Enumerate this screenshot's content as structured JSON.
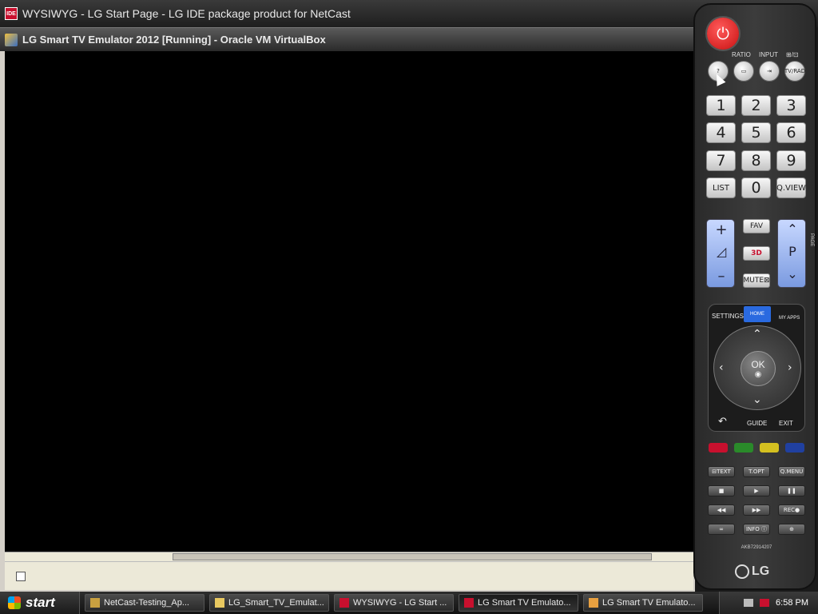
{
  "outer_window": {
    "title": "WYSIWYG - LG Start Page - LG IDE package product for NetCast",
    "icon_text": "IDE"
  },
  "vbox_window": {
    "title": "LG Smart TV Emulator 2012 [Running] - Oracle VM VirtualBox"
  },
  "remote": {
    "labels": {
      "ratio": "RATIO",
      "input": "INPUT",
      "tvrad_top": "⊞/⊡"
    },
    "round_buttons": [
      "?",
      "▭",
      "⇥",
      "TV/RAD"
    ],
    "numpad": [
      "1",
      "2",
      "3",
      "4",
      "5",
      "6",
      "7",
      "8",
      "9",
      "LIST",
      "0",
      "Q.VIEW"
    ],
    "vol": {
      "plus": "+",
      "icon": "◿",
      "minus": "–"
    },
    "mid": [
      "FAV",
      "3D",
      "MUTE⊠"
    ],
    "prog": {
      "up": "⌃",
      "p": "P",
      "down": "⌄",
      "page": "PAGE"
    },
    "nav": {
      "settings": "SETTINGS",
      "home": "HOME",
      "myapps": "MY APPS",
      "ok": "OK",
      "ok_sub": "◉",
      "back": "↶",
      "guide": "GUIDE",
      "exit": "EXIT"
    },
    "lowrow": [
      "⊟TEXT",
      "T.OPT",
      "Q.MENU",
      "■",
      "▶",
      "❚❚",
      "◀◀",
      "▶▶",
      "REC●",
      "∞",
      "INFO ⓘ",
      "⊕"
    ],
    "model": "AKB72914207",
    "brand": "LG",
    "colors": {
      "red": "#c8102e",
      "green": "#2a8a2a",
      "yellow": "#d4c020",
      "blue": "#2040a0"
    }
  },
  "taskbar": {
    "start": "start",
    "tasks": [
      {
        "label": "NetCast-Testing_Ap...",
        "icon_color": "#c8a040",
        "active": false
      },
      {
        "label": "LG_Smart_TV_Emulat...",
        "icon_color": "#e8c860",
        "active": false
      },
      {
        "label": "WYSIWYG - LG Start ...",
        "icon_color": "#c8102e",
        "active": false
      },
      {
        "label": "LG Smart TV Emulato...",
        "icon_color": "#c8102e",
        "active": true
      },
      {
        "label": "LG Smart TV Emulato...",
        "icon_color": "#e8a040",
        "active": false
      }
    ],
    "clock": "6:58 PM"
  }
}
